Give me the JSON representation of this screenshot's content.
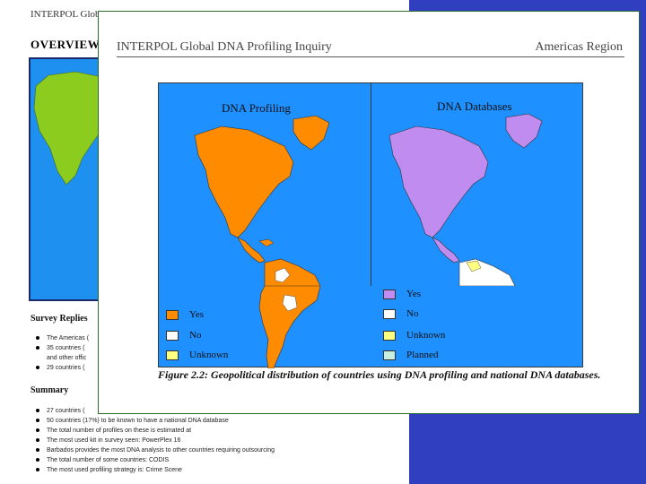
{
  "background_page": {
    "header": "INTERPOL Global",
    "title": "OVERVIEW",
    "survey_heading": "Survey Replies",
    "survey_lines": [
      "The Americas (",
      "35 countries (",
      "and other offic",
      "29 countries ("
    ],
    "summary_heading": "Summary",
    "summary_lines": [
      "27 countries (",
      "50 countries (17%) to be known to have a national DNA database",
      "The total number of profiles on these is estimated at",
      "The most used kit in survey seen: PowerPlex 16",
      "Barbados provides the most DNA analysis to other countries requiring outsourcing",
      "The total number of some countries: CODIS",
      "The most used profiling strategy is: Crime Scene"
    ]
  },
  "window": {
    "title": "INTERPOL Global DNA Profiling Inquiry",
    "region": "Americas Region"
  },
  "figure": {
    "left_panel_title": "DNA Profiling",
    "right_panel_title": "DNA Databases",
    "left_legend": [
      "Yes",
      "No",
      "Unknown"
    ],
    "right_legend": [
      "Yes",
      "No",
      "Unknown",
      "Planned"
    ],
    "caption": "Figure 2.2: Geopolitical distribution of countries using DNA profiling and national DNA databases.",
    "colors": {
      "ocean": "#1e90ff",
      "profiling_yes": "#ff8c00",
      "databases_yes": "#c08cf0",
      "no": "#ffffff",
      "unknown": "#ffff80",
      "planned": "#c8f0e0"
    }
  }
}
